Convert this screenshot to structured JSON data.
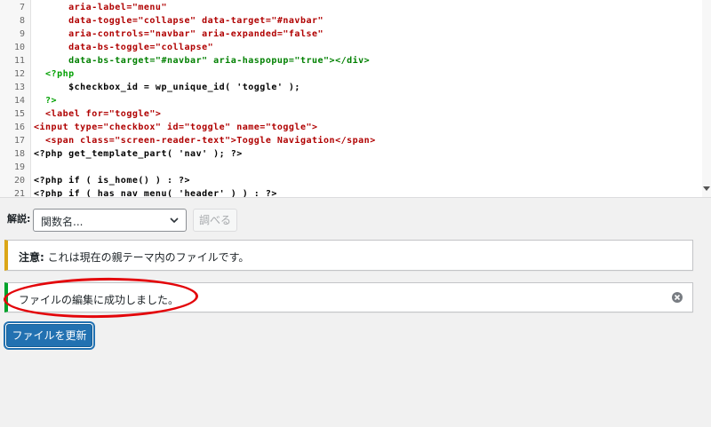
{
  "editor": {
    "lines": [
      {
        "num": "7",
        "text": "      aria-label=\"menu\"",
        "color": "#b00000"
      },
      {
        "num": "8",
        "text": "      data-toggle=\"collapse\" data-target=\"#navbar\"",
        "color": "#b00000"
      },
      {
        "num": "9",
        "text": "      aria-controls=\"navbar\" aria-expanded=\"false\"",
        "color": "#b00000"
      },
      {
        "num": "10",
        "text": "      data-bs-toggle=\"collapse\"",
        "color": "#b00000"
      },
      {
        "num": "11",
        "text": "      data-bs-target=\"#navbar\" aria-haspopup=\"true\"></div>",
        "color": "#008000"
      },
      {
        "num": "12",
        "text": "  <?php",
        "color": "#00a000"
      },
      {
        "num": "13",
        "text": "      $checkbox_id = wp_unique_id( 'toggle' );",
        "color": "#000000"
      },
      {
        "num": "14",
        "text": "  ?>",
        "color": "#00a000"
      },
      {
        "num": "15",
        "text": "  <label for=\"toggle\">",
        "color": "#b00000"
      },
      {
        "num": "16",
        "text": "<input type=\"checkbox\" id=\"toggle\" name=\"toggle\">",
        "color": "#b00000"
      },
      {
        "num": "17",
        "text": "  <span class=\"screen-reader-text\">Toggle Navigation</span>",
        "color": "#b00000"
      },
      {
        "num": "18",
        "text": "<?php get_template_part( 'nav' ); ?>",
        "color": "#000000"
      },
      {
        "num": "19",
        "text": "",
        "color": "#000000"
      },
      {
        "num": "20",
        "text": "<?php if ( is_home() ) : ?>",
        "color": "#000000"
      },
      {
        "num": "21",
        "text": "<?php if ( has_nav_menu( 'header' ) ) : ?>",
        "color": "#000000"
      }
    ]
  },
  "lookup": {
    "label": "解説:",
    "select_value": "関数名...",
    "button_label": "調べる"
  },
  "notices": {
    "warning_strong": "注意:",
    "warning_text": " これは現在の親テーマ内のファイルです。",
    "success_text": "ファイルの編集に成功しました。"
  },
  "actions": {
    "update_label": "ファイルを更新"
  },
  "icons": {
    "select_chevron": "chevron-down-icon",
    "dismiss": "dismiss-icon",
    "scroll_down": "scroll-down-arrow-icon"
  },
  "colors": {
    "primary": "#2271b1",
    "warning_border": "#dba617",
    "success_border": "#00a32a",
    "highlight": "#e3050a"
  }
}
